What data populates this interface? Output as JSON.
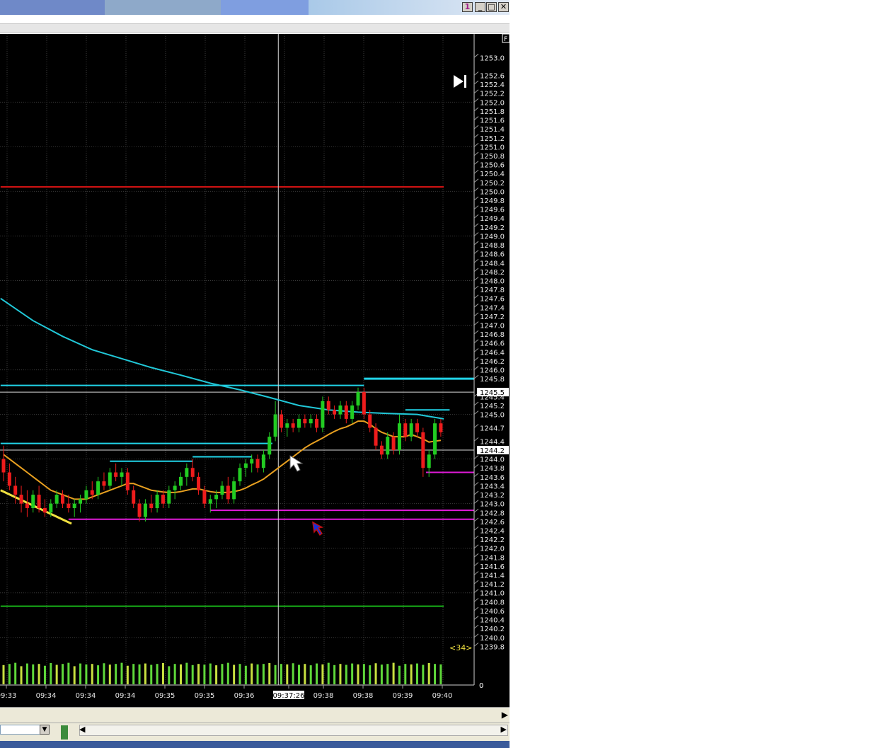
{
  "window": {
    "buttons": [
      "1",
      "_",
      "□",
      "✕"
    ],
    "side_tab": "F"
  },
  "chart_data": {
    "type": "candlestick",
    "y_axis": {
      "ticks": [
        "1253.0",
        "1252.6",
        "1252.4",
        "1252.2",
        "1252.0",
        "1251.8",
        "1251.6",
        "1251.4",
        "1251.2",
        "1251.0",
        "1250.8",
        "1250.6",
        "1250.4",
        "1250.2",
        "1250.0",
        "1249.8",
        "1249.6",
        "1249.4",
        "1249.2",
        "1249.0",
        "1248.8",
        "1248.6",
        "1248.4",
        "1248.2",
        "1248.0",
        "1247.8",
        "1247.6",
        "1247.4",
        "1247.2",
        "1247.0",
        "1246.8",
        "1246.6",
        "1246.4",
        "1246.2",
        "1246.0",
        "1245.8",
        "1245.4",
        "1245.2",
        "1245.0",
        "1244.7",
        "1244.4",
        "1244.0",
        "1243.8",
        "1243.6",
        "1243.4",
        "1243.2",
        "1243.0",
        "1242.8",
        "1242.6",
        "1242.4",
        "1242.2",
        "1242.0",
        "1241.8",
        "1241.6",
        "1241.4",
        "1241.2",
        "1241.0",
        "1240.8",
        "1240.6",
        "1240.4",
        "1240.2",
        "1240.0",
        "1239.8"
      ],
      "highlighted": [
        "1245.5",
        "1244.2"
      ],
      "range": [
        1239.6,
        1253.1
      ]
    },
    "volume_axis_label": "0",
    "x_axis": {
      "ticks": [
        "09:33",
        "09:34",
        "09:34",
        "09:34",
        "09:35",
        "09:35",
        "09:36",
        "09:37:26",
        "09:38",
        "09:38",
        "09:39",
        "09:40"
      ],
      "cursor_label": "09:37:26"
    },
    "bar_counter": "<34>",
    "candles": [
      {
        "o": 1244.0,
        "h": 1244.3,
        "l": 1243.5,
        "c": 1243.7
      },
      {
        "o": 1243.7,
        "h": 1243.9,
        "l": 1243.3,
        "c": 1243.4
      },
      {
        "o": 1243.4,
        "h": 1243.6,
        "l": 1243.0,
        "c": 1243.2
      },
      {
        "o": 1243.2,
        "h": 1243.4,
        "l": 1242.8,
        "c": 1243.0
      },
      {
        "o": 1243.0,
        "h": 1243.3,
        "l": 1242.7,
        "c": 1242.9
      },
      {
        "o": 1242.9,
        "h": 1243.3,
        "l": 1242.8,
        "c": 1243.2
      },
      {
        "o": 1243.2,
        "h": 1243.4,
        "l": 1242.8,
        "c": 1242.9
      },
      {
        "o": 1242.9,
        "h": 1243.1,
        "l": 1242.7,
        "c": 1242.8
      },
      {
        "o": 1242.8,
        "h": 1243.1,
        "l": 1242.7,
        "c": 1243.0
      },
      {
        "o": 1243.0,
        "h": 1243.3,
        "l": 1242.9,
        "c": 1243.2
      },
      {
        "o": 1243.2,
        "h": 1243.3,
        "l": 1242.9,
        "c": 1243.0
      },
      {
        "o": 1243.0,
        "h": 1243.2,
        "l": 1242.8,
        "c": 1242.9
      },
      {
        "o": 1242.9,
        "h": 1243.1,
        "l": 1242.7,
        "c": 1243.0
      },
      {
        "o": 1243.0,
        "h": 1243.2,
        "l": 1242.8,
        "c": 1243.1
      },
      {
        "o": 1243.1,
        "h": 1243.4,
        "l": 1243.0,
        "c": 1243.3
      },
      {
        "o": 1243.3,
        "h": 1243.5,
        "l": 1243.1,
        "c": 1243.2
      },
      {
        "o": 1243.2,
        "h": 1243.6,
        "l": 1243.1,
        "c": 1243.5
      },
      {
        "o": 1243.5,
        "h": 1243.7,
        "l": 1243.3,
        "c": 1243.4
      },
      {
        "o": 1243.4,
        "h": 1243.8,
        "l": 1243.3,
        "c": 1243.7
      },
      {
        "o": 1243.7,
        "h": 1243.9,
        "l": 1243.5,
        "c": 1243.6
      },
      {
        "o": 1243.6,
        "h": 1243.8,
        "l": 1243.4,
        "c": 1243.7
      },
      {
        "o": 1243.7,
        "h": 1243.8,
        "l": 1243.2,
        "c": 1243.3
      },
      {
        "o": 1243.3,
        "h": 1243.4,
        "l": 1242.9,
        "c": 1243.0
      },
      {
        "o": 1243.0,
        "h": 1243.1,
        "l": 1242.6,
        "c": 1242.7
      },
      {
        "o": 1242.7,
        "h": 1243.1,
        "l": 1242.6,
        "c": 1243.0
      },
      {
        "o": 1243.0,
        "h": 1243.2,
        "l": 1242.8,
        "c": 1242.9
      },
      {
        "o": 1242.9,
        "h": 1243.3,
        "l": 1242.8,
        "c": 1243.2
      },
      {
        "o": 1243.2,
        "h": 1243.3,
        "l": 1242.9,
        "c": 1243.0
      },
      {
        "o": 1243.0,
        "h": 1243.4,
        "l": 1242.9,
        "c": 1243.3
      },
      {
        "o": 1243.3,
        "h": 1243.5,
        "l": 1243.1,
        "c": 1243.4
      },
      {
        "o": 1243.4,
        "h": 1243.7,
        "l": 1243.3,
        "c": 1243.6
      },
      {
        "o": 1243.6,
        "h": 1243.9,
        "l": 1243.4,
        "c": 1243.8
      },
      {
        "o": 1243.8,
        "h": 1244.0,
        "l": 1243.5,
        "c": 1243.6
      },
      {
        "o": 1243.6,
        "h": 1243.7,
        "l": 1243.2,
        "c": 1243.3
      },
      {
        "o": 1243.3,
        "h": 1243.4,
        "l": 1242.9,
        "c": 1243.0
      },
      {
        "o": 1243.0,
        "h": 1243.2,
        "l": 1242.8,
        "c": 1243.1
      },
      {
        "o": 1243.1,
        "h": 1243.3,
        "l": 1242.9,
        "c": 1243.2
      },
      {
        "o": 1243.2,
        "h": 1243.5,
        "l": 1243.1,
        "c": 1243.4
      },
      {
        "o": 1243.4,
        "h": 1243.6,
        "l": 1243.0,
        "c": 1243.1
      },
      {
        "o": 1243.1,
        "h": 1243.6,
        "l": 1243.0,
        "c": 1243.5
      },
      {
        "o": 1243.5,
        "h": 1243.9,
        "l": 1243.4,
        "c": 1243.8
      },
      {
        "o": 1243.8,
        "h": 1244.0,
        "l": 1243.6,
        "c": 1243.9
      },
      {
        "o": 1243.9,
        "h": 1244.1,
        "l": 1243.7,
        "c": 1244.0
      },
      {
        "o": 1244.0,
        "h": 1244.1,
        "l": 1243.7,
        "c": 1243.8
      },
      {
        "o": 1243.8,
        "h": 1244.2,
        "l": 1243.7,
        "c": 1244.1
      },
      {
        "o": 1244.1,
        "h": 1244.6,
        "l": 1244.0,
        "c": 1244.5
      },
      {
        "o": 1244.5,
        "h": 1245.3,
        "l": 1244.4,
        "c": 1245.0
      },
      {
        "o": 1245.0,
        "h": 1245.1,
        "l": 1244.6,
        "c": 1244.7
      },
      {
        "o": 1244.7,
        "h": 1244.9,
        "l": 1244.5,
        "c": 1244.8
      },
      {
        "o": 1244.8,
        "h": 1244.9,
        "l": 1244.6,
        "c": 1244.7
      },
      {
        "o": 1244.7,
        "h": 1245.0,
        "l": 1244.6,
        "c": 1244.9
      },
      {
        "o": 1244.9,
        "h": 1245.0,
        "l": 1244.7,
        "c": 1244.8
      },
      {
        "o": 1244.8,
        "h": 1245.0,
        "l": 1244.7,
        "c": 1244.9
      },
      {
        "o": 1244.9,
        "h": 1245.0,
        "l": 1244.6,
        "c": 1244.7
      },
      {
        "o": 1244.7,
        "h": 1245.4,
        "l": 1244.6,
        "c": 1245.3
      },
      {
        "o": 1245.3,
        "h": 1245.4,
        "l": 1245.0,
        "c": 1245.1
      },
      {
        "o": 1245.1,
        "h": 1245.2,
        "l": 1244.9,
        "c": 1245.0
      },
      {
        "o": 1245.0,
        "h": 1245.3,
        "l": 1244.9,
        "c": 1245.2
      },
      {
        "o": 1245.2,
        "h": 1245.3,
        "l": 1244.8,
        "c": 1244.9
      },
      {
        "o": 1244.9,
        "h": 1245.3,
        "l": 1244.8,
        "c": 1245.2
      },
      {
        "o": 1245.2,
        "h": 1245.6,
        "l": 1245.1,
        "c": 1245.5
      },
      {
        "o": 1245.5,
        "h": 1245.6,
        "l": 1244.9,
        "c": 1245.0
      },
      {
        "o": 1245.0,
        "h": 1245.1,
        "l": 1244.6,
        "c": 1244.7
      },
      {
        "o": 1244.7,
        "h": 1244.8,
        "l": 1244.2,
        "c": 1244.3
      },
      {
        "o": 1244.3,
        "h": 1244.4,
        "l": 1244.0,
        "c": 1244.1
      },
      {
        "o": 1244.1,
        "h": 1244.6,
        "l": 1244.0,
        "c": 1244.5
      },
      {
        "o": 1244.5,
        "h": 1244.6,
        "l": 1244.1,
        "c": 1244.2
      },
      {
        "o": 1244.2,
        "h": 1245.0,
        "l": 1244.1,
        "c": 1244.8
      },
      {
        "o": 1244.8,
        "h": 1244.9,
        "l": 1244.4,
        "c": 1244.5
      },
      {
        "o": 1244.5,
        "h": 1244.9,
        "l": 1244.4,
        "c": 1244.8
      },
      {
        "o": 1244.8,
        "h": 1244.9,
        "l": 1244.5,
        "c": 1244.6
      },
      {
        "o": 1244.6,
        "h": 1244.7,
        "l": 1243.6,
        "c": 1243.8
      },
      {
        "o": 1243.8,
        "h": 1244.2,
        "l": 1243.6,
        "c": 1244.1
      },
      {
        "o": 1244.1,
        "h": 1244.9,
        "l": 1244.0,
        "c": 1244.8
      },
      {
        "o": 1244.8,
        "h": 1244.9,
        "l": 1244.5,
        "c": 1244.6
      }
    ],
    "moving_average_fast": [
      1244.1,
      1244.0,
      1243.9,
      1243.8,
      1243.7,
      1243.6,
      1243.5,
      1243.4,
      1243.3,
      1243.25,
      1243.2,
      1243.15,
      1243.1,
      1243.1,
      1243.1,
      1243.15,
      1243.2,
      1243.25,
      1243.3,
      1243.35,
      1243.4,
      1243.45,
      1243.45,
      1243.4,
      1243.35,
      1243.3,
      1243.28,
      1243.26,
      1243.25,
      1243.25,
      1243.27,
      1243.3,
      1243.33,
      1243.33,
      1243.3,
      1243.27,
      1243.25,
      1243.25,
      1243.25,
      1243.27,
      1243.3,
      1243.35,
      1243.42,
      1243.48,
      1243.55,
      1243.65,
      1243.75,
      1243.85,
      1243.95,
      1244.05,
      1244.15,
      1244.25,
      1244.33,
      1244.4,
      1244.47,
      1244.55,
      1244.62,
      1244.68,
      1244.72,
      1244.78,
      1244.85,
      1244.85,
      1244.78,
      1244.68,
      1244.6,
      1244.55,
      1244.5,
      1244.5,
      1244.5,
      1244.55,
      1244.5,
      1244.45,
      1244.38,
      1244.4,
      1244.42
    ],
    "moving_average_slow": [
      {
        "i": -0.5,
        "v": 1247.6
      },
      {
        "i": 5,
        "v": 1247.1
      },
      {
        "i": 10,
        "v": 1246.75
      },
      {
        "i": 15,
        "v": 1246.45
      },
      {
        "i": 20,
        "v": 1246.25
      },
      {
        "i": 25,
        "v": 1246.05
      },
      {
        "i": 30,
        "v": 1245.88
      },
      {
        "i": 35,
        "v": 1245.7
      },
      {
        "i": 40,
        "v": 1245.55
      },
      {
        "i": 45,
        "v": 1245.38
      },
      {
        "i": 50,
        "v": 1245.2
      },
      {
        "i": 55,
        "v": 1245.1
      },
      {
        "i": 60,
        "v": 1245.05
      },
      {
        "i": 65,
        "v": 1245.02
      },
      {
        "i": 70,
        "v": 1245.0
      },
      {
        "i": 74.5,
        "v": 1244.9
      }
    ],
    "levels": [
      {
        "name": "red-level",
        "price": 1250.1,
        "from": -0.5,
        "to": 74.5,
        "color": "#e01414",
        "width": 2
      },
      {
        "name": "green-level",
        "price": 1240.7,
        "from": -0.5,
        "to": 74.5,
        "color": "#18b418",
        "width": 2
      },
      {
        "name": "cyan-level-long",
        "price": 1245.65,
        "from": -0.5,
        "to": 61,
        "color": "#21d4e8",
        "width": 2
      },
      {
        "name": "cyan-level-right",
        "price": 1245.8,
        "from": 61,
        "to": 80,
        "color": "#21d4e8",
        "width": 3
      },
      {
        "name": "cyan-level-late",
        "price": 1245.1,
        "from": 68,
        "to": 75.5,
        "color": "#21d4e8",
        "width": 2
      },
      {
        "name": "cyan-level-left",
        "price": 1244.35,
        "from": -0.5,
        "to": 45.5,
        "color": "#21d4e8",
        "width": 2
      },
      {
        "name": "cyan-level-mid1",
        "price": 1243.95,
        "from": 18,
        "to": 32,
        "color": "#21d4e8",
        "width": 2
      },
      {
        "name": "cyan-level-mid2",
        "price": 1244.05,
        "from": 32,
        "to": 42,
        "color": "#21d4e8",
        "width": 2
      },
      {
        "name": "magenta-level-long",
        "price": 1242.65,
        "from": 11,
        "to": 80,
        "color": "#e01ad8",
        "width": 2
      },
      {
        "name": "magenta-level-mid",
        "price": 1242.85,
        "from": 35,
        "to": 80,
        "color": "#e01ad8",
        "width": 2
      },
      {
        "name": "magenta-level-right",
        "price": 1243.7,
        "from": 71.5,
        "to": 80,
        "color": "#e01ad8",
        "width": 2
      }
    ],
    "trendline": {
      "from": {
        "i": -0.5,
        "v": 1243.3
      },
      "to": {
        "i": 11.5,
        "v": 1242.55
      },
      "color": "#f0e040"
    },
    "crosshair": {
      "i": 46.5,
      "v": 1245.5
    },
    "volumes": [
      0.85,
      0.9,
      0.95,
      0.8,
      0.92,
      0.88,
      0.9,
      0.82,
      0.94,
      0.86,
      0.9,
      0.95,
      0.8,
      0.92,
      0.88,
      0.9,
      0.84,
      0.93,
      0.87,
      0.9,
      0.95,
      0.82,
      0.9,
      0.88,
      0.92,
      0.86,
      0.9,
      0.94,
      0.8,
      0.9,
      0.88,
      0.95,
      0.85,
      0.9,
      0.87,
      0.92,
      0.84,
      0.9,
      0.95,
      0.86,
      0.9,
      0.82,
      0.92,
      0.88,
      0.9,
      0.94,
      0.85,
      0.9,
      0.88,
      0.93,
      0.86,
      0.9,
      0.84,
      0.92,
      0.88,
      0.95,
      0.85,
      0.9,
      0.86,
      0.92,
      0.88,
      0.9,
      0.84,
      0.93,
      0.87,
      0.9,
      0.95,
      0.82,
      0.9,
      0.88,
      0.92,
      0.86,
      0.94,
      0.9,
      0.88
    ]
  }
}
